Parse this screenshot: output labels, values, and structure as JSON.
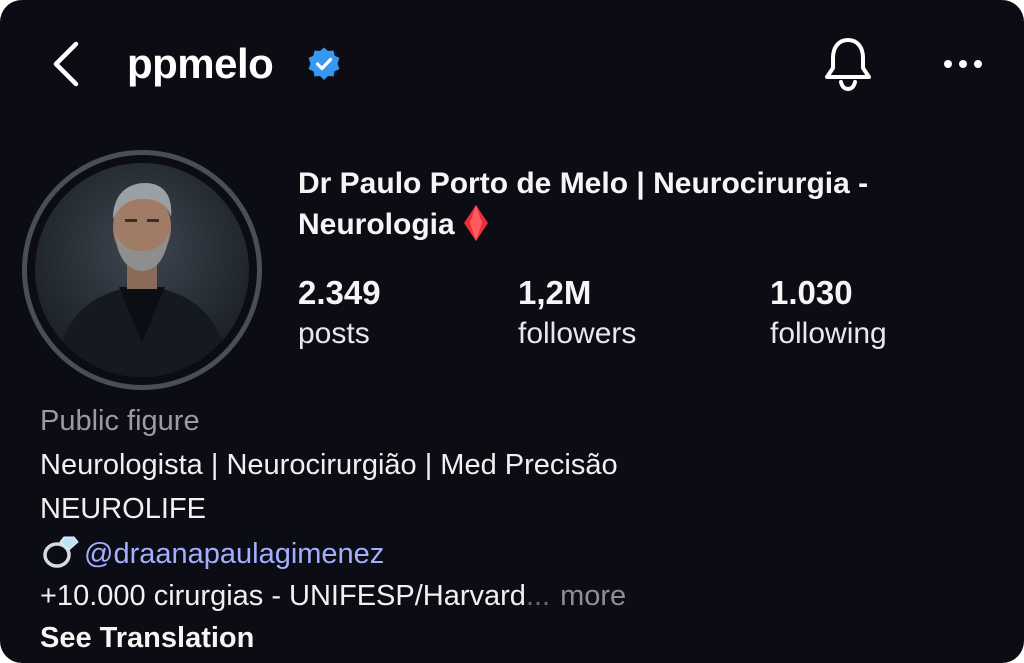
{
  "header": {
    "username": "ppmelo",
    "verified": true,
    "back_icon": "chevron-left-icon",
    "bell_icon": "bell-icon",
    "more_icon": "more-horizontal-icon"
  },
  "profile": {
    "full_name_line1": "Dr Paulo Porto de Melo | Neurocirurgia -",
    "full_name_line2": "Neurologia",
    "name_emoji": "red-diamond-icon",
    "stats": {
      "posts": {
        "value": "2.349",
        "label": "posts"
      },
      "followers": {
        "value": "1,2M",
        "label": "followers"
      },
      "following": {
        "value": "1.030",
        "label": "following"
      }
    }
  },
  "bio": {
    "category": "Public figure",
    "line1": "Neurologista | Neurocirurgião | Med Precisão",
    "line2": "NEUROLIFE",
    "mention": "@draanapaulagimenez",
    "mention_emoji": "ring-icon",
    "line4": "+10.000 cirurgias - UNIFESP/Harvard",
    "ellipsis": "...",
    "more_label": "more",
    "see_translation": "See Translation"
  },
  "colors": {
    "background": "#0c0c14",
    "verified_badge": "#3897f0",
    "mention": "#a4aeff",
    "category": "#9a9aa4"
  }
}
